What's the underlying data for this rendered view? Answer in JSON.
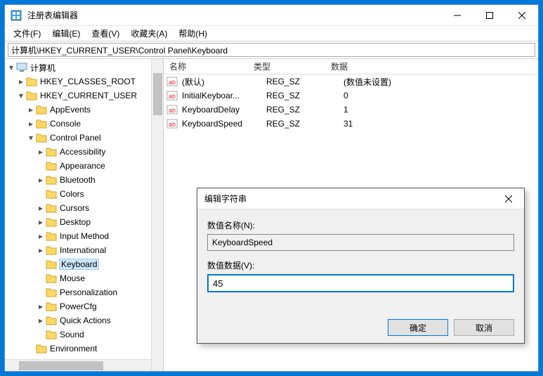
{
  "window": {
    "title": "注册表编辑器",
    "controls": {
      "min": "min",
      "max": "max",
      "close": "close"
    }
  },
  "menu": {
    "file": "文件(F)",
    "edit": "编辑(E)",
    "view": "查看(V)",
    "fav": "收藏夹(A)",
    "help": "帮助(H)"
  },
  "address": "计算机\\HKEY_CURRENT_USER\\Control Panel\\Keyboard",
  "tree": {
    "root": "计算机",
    "hkcr": "HKEY_CLASSES_ROOT",
    "hkcu": "HKEY_CURRENT_USER",
    "appevents": "AppEvents",
    "console": "Console",
    "controlpanel": "Control Panel",
    "accessibility": "Accessibility",
    "appearance": "Appearance",
    "bluetooth": "Bluetooth",
    "colors": "Colors",
    "cursors": "Cursors",
    "desktop": "Desktop",
    "inputmethod": "Input Method",
    "international": "International",
    "keyboard": "Keyboard",
    "mouse": "Mouse",
    "personalization": "Personalization",
    "powercfg": "PowerCfg",
    "quickactions": "Quick Actions",
    "sound": "Sound",
    "environment": "Environment"
  },
  "list": {
    "headers": {
      "name": "名称",
      "type": "类型",
      "data": "数据"
    },
    "rows": [
      {
        "name": "(默认)",
        "type": "REG_SZ",
        "data": "(数值未设置)"
      },
      {
        "name": "InitialKeyboar...",
        "type": "REG_SZ",
        "data": "0"
      },
      {
        "name": "KeyboardDelay",
        "type": "REG_SZ",
        "data": "1"
      },
      {
        "name": "KeyboardSpeed",
        "type": "REG_SZ",
        "data": "31"
      }
    ]
  },
  "dialog": {
    "title": "编辑字符串",
    "name_label": "数值名称(N):",
    "name_value": "KeyboardSpeed",
    "data_label": "数值数据(V):",
    "data_value": "45",
    "ok": "确定",
    "cancel": "取消"
  }
}
